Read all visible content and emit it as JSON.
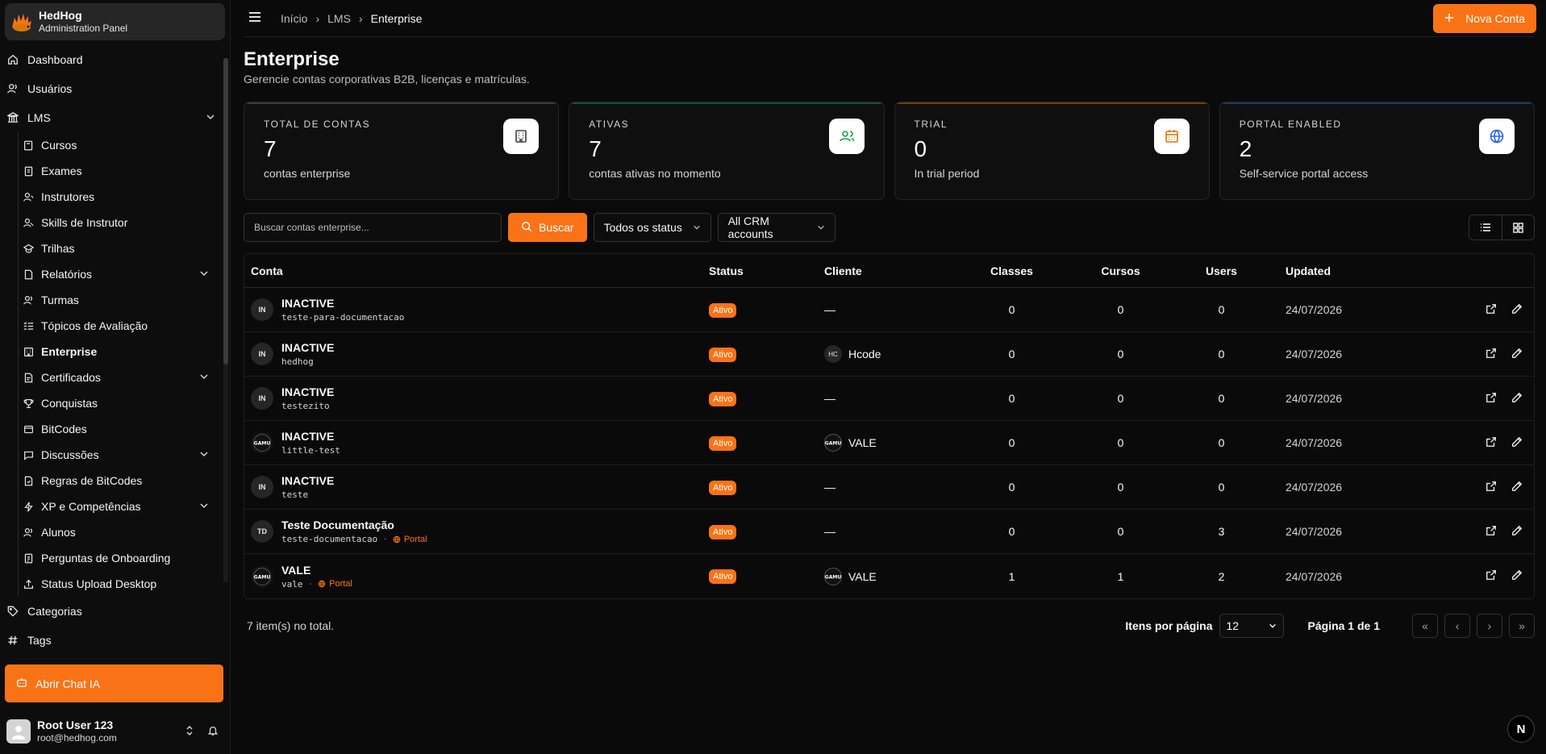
{
  "brand": {
    "name": "HedHog",
    "subtitle": "Administration Panel"
  },
  "sidebar": {
    "top_items": [
      {
        "label": "Dashboard",
        "icon": "home-icon"
      },
      {
        "label": "Usuários",
        "icon": "users-icon"
      },
      {
        "label": "LMS",
        "icon": "library-icon"
      }
    ],
    "lms_items": [
      {
        "label": "Cursos",
        "icon": "book-icon"
      },
      {
        "label": "Exames",
        "icon": "exam-icon"
      },
      {
        "label": "Instrutores",
        "icon": "instructor-icon"
      },
      {
        "label": "Skills de Instrutor",
        "icon": "skills-icon"
      },
      {
        "label": "Trilhas",
        "icon": "path-icon"
      },
      {
        "label": "Relatórios",
        "icon": "reports-icon"
      },
      {
        "label": "Turmas",
        "icon": "classes-icon"
      },
      {
        "label": "Tópicos de Avaliação",
        "icon": "topics-icon"
      },
      {
        "label": "Enterprise",
        "icon": "enterprise-icon"
      },
      {
        "label": "Certificados",
        "icon": "certificate-icon"
      },
      {
        "label": "Conquistas",
        "icon": "trophy-icon"
      },
      {
        "label": "BitCodes",
        "icon": "bitcodes-icon"
      },
      {
        "label": "Discussões",
        "icon": "discussions-icon"
      },
      {
        "label": "Regras de BitCodes",
        "icon": "rules-icon"
      },
      {
        "label": "XP e Competências",
        "icon": "xp-icon"
      },
      {
        "label": "Alunos",
        "icon": "students-icon"
      },
      {
        "label": "Perguntas de Onboarding",
        "icon": "onboarding-icon"
      },
      {
        "label": "Status Upload Desktop",
        "icon": "upload-icon"
      }
    ],
    "bottom_items": [
      {
        "label": "Categorias",
        "icon": "tag-icon"
      },
      {
        "label": "Tags",
        "icon": "hash-icon"
      }
    ],
    "chat_button": "Abrir Chat IA"
  },
  "user": {
    "name": "Root User 123",
    "email": "root@hedhog.com"
  },
  "topbar": {
    "breadcrumb": [
      "Início",
      "LMS",
      "Enterprise"
    ],
    "new_button": "Nova Conta"
  },
  "page": {
    "title": "Enterprise",
    "subtitle": "Gerencie contas corporativas B2B, licenças e matrículas."
  },
  "stats": [
    {
      "label": "TOTAL DE CONTAS",
      "value": "7",
      "desc": "contas enterprise",
      "icon": "building-icon",
      "accent": "#3a3a3a",
      "icon_color": "#404040"
    },
    {
      "label": "ATIVAS",
      "value": "7",
      "desc": "contas ativas no momento",
      "icon": "users-icon",
      "accent": "#14532d",
      "icon_color": "#16a34a"
    },
    {
      "label": "TRIAL",
      "value": "0",
      "desc": "In trial period",
      "icon": "calendar-icon",
      "accent": "#713f12",
      "icon_color": "#d97706"
    },
    {
      "label": "PORTAL ENABLED",
      "value": "2",
      "desc": "Self-service portal access",
      "icon": "globe-icon",
      "accent": "#1e3a5f",
      "icon_color": "#2563eb"
    }
  ],
  "toolbar": {
    "search_placeholder": "Buscar contas enterprise...",
    "search_button": "Buscar",
    "status_filter": "Todos os status",
    "crm_filter": "All CRM accounts"
  },
  "table": {
    "headers": {
      "conta": "Conta",
      "status": "Status",
      "cliente": "Cliente",
      "classes": "Classes",
      "cursos": "Cursos",
      "users": "Users",
      "updated": "Updated"
    },
    "rows": [
      {
        "avatar": "IN",
        "name": "INACTIVE",
        "slug": "teste-para-documentacao",
        "portal": "",
        "status": "Ativo",
        "client": "—",
        "client_avatar": "",
        "classes": "0",
        "cursos": "0",
        "users": "0",
        "updated": "24/07/2026"
      },
      {
        "avatar": "IN",
        "name": "INACTIVE",
        "slug": "hedhog",
        "portal": "",
        "status": "Ativo",
        "client": "Hcode",
        "client_avatar": "HC",
        "classes": "0",
        "cursos": "0",
        "users": "0",
        "updated": "24/07/2026"
      },
      {
        "avatar": "IN",
        "name": "INACTIVE",
        "slug": "testezito",
        "portal": "",
        "status": "Ativo",
        "client": "—",
        "client_avatar": "",
        "classes": "0",
        "cursos": "0",
        "users": "0",
        "updated": "24/07/2026"
      },
      {
        "avatar": "GAMU",
        "name": "INACTIVE",
        "slug": "little-test",
        "portal": "",
        "status": "Ativo",
        "client": "VALE",
        "client_avatar": "GAMU",
        "classes": "0",
        "cursos": "0",
        "users": "0",
        "updated": "24/07/2026"
      },
      {
        "avatar": "IN",
        "name": "INACTIVE",
        "slug": "teste",
        "portal": "",
        "status": "Ativo",
        "client": "—",
        "client_avatar": "",
        "classes": "0",
        "cursos": "0",
        "users": "0",
        "updated": "24/07/2026"
      },
      {
        "avatar": "TD",
        "name": "Teste Documentação",
        "slug": "teste-documentacao",
        "portal": "Portal",
        "status": "Ativo",
        "client": "—",
        "client_avatar": "",
        "classes": "0",
        "cursos": "0",
        "users": "3",
        "updated": "24/07/2026"
      },
      {
        "avatar": "GAMU",
        "name": "VALE",
        "slug": "vale",
        "portal": "Portal",
        "status": "Ativo",
        "client": "VALE",
        "client_avatar": "GAMU",
        "classes": "1",
        "cursos": "1",
        "users": "2",
        "updated": "24/07/2026"
      }
    ]
  },
  "footer": {
    "total": "7 item(s) no total.",
    "per_page_label": "Itens por página",
    "per_page_value": "12",
    "page_info": "Página 1 de 1"
  },
  "floating_badge": "N",
  "colors": {
    "accent": "#f97316",
    "background": "#0a0a0a"
  }
}
